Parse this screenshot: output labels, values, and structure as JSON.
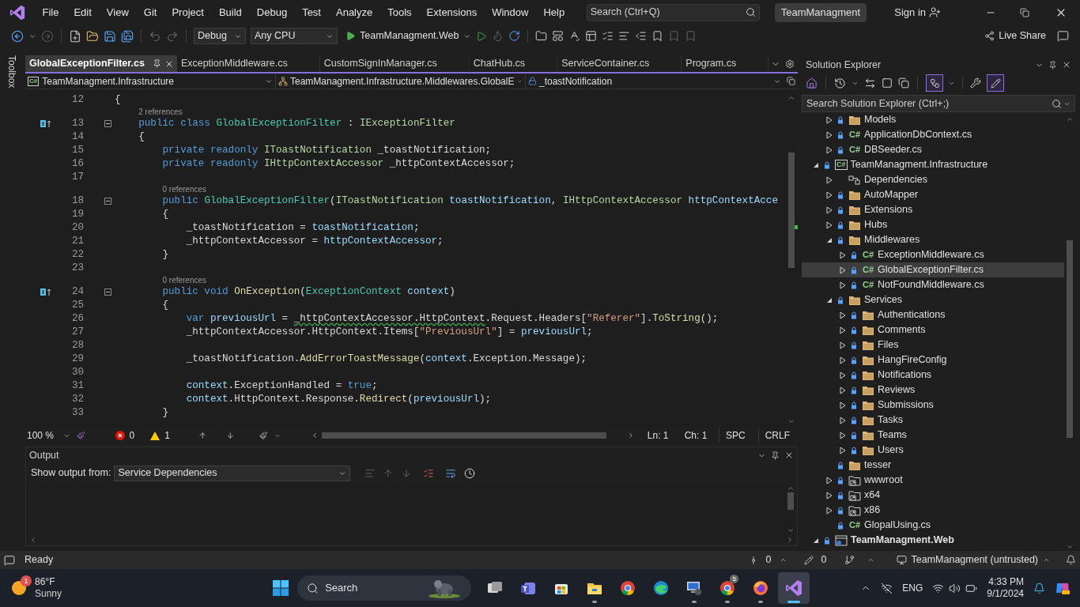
{
  "menu": [
    "File",
    "Edit",
    "View",
    "Git",
    "Project",
    "Build",
    "Debug",
    "Test",
    "Analyze",
    "Tools",
    "Extensions",
    "Window",
    "Help"
  ],
  "search": {
    "placeholder": "Search (Ctrl+Q)"
  },
  "solution_name": "TeamManagment",
  "sign_in": "Sign in",
  "toolbar": {
    "configuration": "Debug",
    "platform": "Any CPU",
    "startup": "TeamManagment.Web",
    "live_share": "Live Share"
  },
  "toolbox": "Toolbox",
  "tabs": [
    {
      "label": "GlobalExceptionFilter.cs",
      "selected": true
    },
    {
      "label": "ExceptionMiddleware.cs",
      "selected": false
    },
    {
      "label": "CustomSignInManager.cs",
      "selected": false
    },
    {
      "label": "ChatHub.cs",
      "selected": false
    },
    {
      "label": "ServiceContainer.cs",
      "selected": false
    },
    {
      "label": "Program.cs",
      "selected": false
    }
  ],
  "nav": {
    "project_icon": "C#",
    "project": "TeamManagment.Infrastructure",
    "type": "TeamManagment.Infrastructure.Middlewares.GlobalE",
    "member": "_toastNotification"
  },
  "code": [
    {
      "number": "12",
      "implements": false,
      "tokens": [
        {
          "kind": "p",
          "text": "{"
        }
      ]
    },
    {
      "number": "13",
      "implements": true,
      "lens": "2 references",
      "folded": false,
      "tokens": [
        {
          "kind": "k",
          "text": "    public class "
        },
        {
          "kind": "t",
          "text": "GlobalExceptionFilter"
        },
        {
          "kind": "p",
          "text": " : "
        },
        {
          "kind": "i",
          "text": "IExceptionFilter"
        }
      ]
    },
    {
      "number": "14",
      "implements": false,
      "tokens": [
        {
          "kind": "p",
          "text": "    {"
        }
      ]
    },
    {
      "number": "15",
      "implements": false,
      "tokens": [
        {
          "kind": "k",
          "text": "        private readonly "
        },
        {
          "kind": "i",
          "text": "IToastNotification"
        },
        {
          "kind": "p",
          "text": " _toastNotification;"
        }
      ]
    },
    {
      "number": "16",
      "implements": false,
      "tokens": [
        {
          "kind": "k",
          "text": "        private readonly "
        },
        {
          "kind": "i",
          "text": "IHttpContextAccessor"
        },
        {
          "kind": "p",
          "text": " _httpContextAccessor;"
        }
      ]
    },
    {
      "number": "17",
      "implements": false
    },
    {
      "number": "18",
      "implements": false,
      "lens": "0 references",
      "folded": false,
      "tokens": [
        {
          "kind": "k",
          "text": "        public "
        },
        {
          "kind": "t",
          "text": "GlobalExceptionFilter"
        },
        {
          "kind": "p",
          "text": "("
        },
        {
          "kind": "i",
          "text": "IToastNotification"
        },
        {
          "kind": "v",
          "text": " toastNotification"
        },
        {
          "kind": "p",
          "text": ", "
        },
        {
          "kind": "i",
          "text": "IHttpContextAccessor"
        },
        {
          "kind": "v",
          "text": " httpContextAcce"
        }
      ]
    },
    {
      "number": "19",
      "implements": false,
      "tokens": [
        {
          "kind": "p",
          "text": "        {"
        }
      ]
    },
    {
      "number": "20",
      "implements": false,
      "tokens": [
        {
          "kind": "p",
          "text": "            _toastNotification = "
        },
        {
          "kind": "v",
          "text": "toastNotification"
        },
        {
          "kind": "p",
          "text": ";"
        }
      ]
    },
    {
      "number": "21",
      "implements": false,
      "tokens": [
        {
          "kind": "p",
          "text": "            _httpContextAccessor = "
        },
        {
          "kind": "v",
          "text": "httpContextAccessor"
        },
        {
          "kind": "p",
          "text": ";"
        }
      ]
    },
    {
      "number": "22",
      "implements": false,
      "tokens": [
        {
          "kind": "p",
          "text": "        }"
        }
      ]
    },
    {
      "number": "23",
      "implements": false
    },
    {
      "number": "24",
      "implements": true,
      "lens": "0 references",
      "folded": false,
      "tokens": [
        {
          "kind": "k",
          "text": "        public void "
        },
        {
          "kind": "m",
          "text": "OnException"
        },
        {
          "kind": "p",
          "text": "("
        },
        {
          "kind": "t",
          "text": "ExceptionContext"
        },
        {
          "kind": "v",
          "text": " context"
        },
        {
          "kind": "p",
          "text": ")"
        }
      ]
    },
    {
      "number": "25",
      "implements": false,
      "tokens": [
        {
          "kind": "p",
          "text": "        {"
        }
      ]
    },
    {
      "number": "26",
      "implements": false,
      "tokens": [
        {
          "kind": "k",
          "text": "            var "
        },
        {
          "kind": "v",
          "text": "previousUrl"
        },
        {
          "kind": "p",
          "text": " = "
        },
        {
          "kind": "w",
          "text": "_httpContextAccessor.HttpContext"
        },
        {
          "kind": "p",
          "text": ".Request.Headers["
        },
        {
          "kind": "s",
          "text": "\"Referer\""
        },
        {
          "kind": "p",
          "text": "]."
        },
        {
          "kind": "m",
          "text": "ToString"
        },
        {
          "kind": "p",
          "text": "();"
        }
      ]
    },
    {
      "number": "27",
      "implements": false,
      "tokens": [
        {
          "kind": "p",
          "text": "            _httpContextAccessor.HttpContext.Items["
        },
        {
          "kind": "s",
          "text": "\"PreviousUrl\""
        },
        {
          "kind": "p",
          "text": "] = "
        },
        {
          "kind": "v",
          "text": "previousUrl"
        },
        {
          "kind": "p",
          "text": ";"
        }
      ]
    },
    {
      "number": "28",
      "implements": false
    },
    {
      "number": "29",
      "implements": false,
      "tokens": [
        {
          "kind": "p",
          "text": "            _toastNotification."
        },
        {
          "kind": "m",
          "text": "AddErrorToastMessage"
        },
        {
          "kind": "p",
          "text": "("
        },
        {
          "kind": "v",
          "text": "context"
        },
        {
          "kind": "p",
          "text": ".Exception.Message);"
        }
      ]
    },
    {
      "number": "30",
      "implements": false
    },
    {
      "number": "31",
      "implements": false,
      "tokens": [
        {
          "kind": "v",
          "text": "            context"
        },
        {
          "kind": "p",
          "text": ".ExceptionHandled = "
        },
        {
          "kind": "k",
          "text": "true"
        },
        {
          "kind": "p",
          "text": ";"
        }
      ]
    },
    {
      "number": "32",
      "implements": false,
      "tokens": [
        {
          "kind": "v",
          "text": "            context"
        },
        {
          "kind": "p",
          "text": ".HttpContext.Response."
        },
        {
          "kind": "m",
          "text": "Redirect"
        },
        {
          "kind": "p",
          "text": "("
        },
        {
          "kind": "v",
          "text": "previousUrl"
        },
        {
          "kind": "p",
          "text": ");"
        }
      ]
    },
    {
      "number": "33",
      "implements": false,
      "tokens": [
        {
          "kind": "p",
          "text": "        }"
        }
      ]
    }
  ],
  "editor_status": {
    "zoom": "100 %",
    "errors": "0",
    "warnings": "1",
    "line": "Ln: 1",
    "column": "Ch: 1",
    "whitespace": "SPC",
    "line_ending": "CRLF"
  },
  "output": {
    "title": "Output",
    "source_label": "Show output from:",
    "source": "Service Dependencies"
  },
  "solution_explorer": {
    "title": "Solution Explorer",
    "toggles": [
      {
        "kind": "track",
        "on": true
      },
      {
        "kind": "preview",
        "on": true
      }
    ],
    "search": {
      "placeholder": "Search Solution Explorer (Ctrl+;)"
    },
    "tree": [
      {
        "children": [
          {
            "label": "Models",
            "kind": "folder",
            "locked": true,
            "expanded": false,
            "selected": false
          },
          {
            "label": "ApplicationDbContext.cs",
            "kind": "csharp",
            "icon_text": "C#",
            "locked": true,
            "expanded": false,
            "selected": false
          },
          {
            "label": "DBSeeder.cs",
            "kind": "csharp",
            "icon_text": "C#",
            "locked": true,
            "expanded": false,
            "selected": false
          }
        ]
      },
      {
        "label": "TeamManagment.Infrastructure",
        "kind": "project",
        "icon_text": "C#",
        "locked": true,
        "expanded": true,
        "selected": false,
        "children": [
          {
            "label": "Dependencies",
            "kind": "dependencies",
            "locked": false,
            "expanded": false,
            "selected": false
          },
          {
            "label": "AutoMapper",
            "kind": "folder",
            "locked": true,
            "expanded": false,
            "selected": false
          },
          {
            "label": "Extensions",
            "kind": "folder",
            "locked": true,
            "expanded": false,
            "selected": false
          },
          {
            "label": "Hubs",
            "kind": "folder",
            "locked": true,
            "expanded": false,
            "selected": false
          },
          {
            "label": "Middlewares",
            "kind": "folder",
            "locked": true,
            "expanded": true,
            "selected": false,
            "children": [
              {
                "label": "ExceptionMiddleware.cs",
                "kind": "csharp",
                "icon_text": "C#",
                "locked": true,
                "expanded": false,
                "selected": false
              },
              {
                "label": "GlobalExceptionFilter.cs",
                "kind": "csharp",
                "icon_text": "C#",
                "locked": true,
                "expanded": false,
                "selected": true
              },
              {
                "label": "NotFoundMiddleware.cs",
                "kind": "csharp",
                "icon_text": "C#",
                "locked": true,
                "expanded": false,
                "selected": false
              }
            ]
          },
          {
            "label": "Services",
            "kind": "folder",
            "locked": true,
            "expanded": true,
            "selected": false,
            "children": [
              {
                "label": "Authentications",
                "kind": "folder",
                "locked": true,
                "expanded": false,
                "selected": false
              },
              {
                "label": "Comments",
                "kind": "folder",
                "locked": true,
                "expanded": false,
                "selected": false
              },
              {
                "label": "Files",
                "kind": "folder",
                "locked": true,
                "expanded": false,
                "selected": false
              },
              {
                "label": "HangFireConfig",
                "kind": "folder",
                "locked": true,
                "expanded": false,
                "selected": false
              },
              {
                "label": "Notifications",
                "kind": "folder",
                "locked": true,
                "expanded": false,
                "selected": false
              },
              {
                "label": "Reviews",
                "kind": "folder",
                "locked": true,
                "expanded": false,
                "selected": false
              },
              {
                "label": "Submissions",
                "kind": "folder",
                "locked": true,
                "expanded": false,
                "selected": false
              },
              {
                "label": "Tasks",
                "kind": "folder",
                "locked": true,
                "expanded": false,
                "selected": false
              },
              {
                "label": "Teams",
                "kind": "folder",
                "locked": true,
                "expanded": false,
                "selected": false
              },
              {
                "label": "Users",
                "kind": "folder",
                "locked": true,
                "expanded": false,
                "selected": false
              }
            ]
          },
          {
            "label": "tesser",
            "kind": "folder",
            "locked": true,
            "selected": false
          },
          {
            "label": "wwwroot",
            "kind": "linked-folder",
            "locked": true,
            "expanded": false,
            "selected": false
          },
          {
            "label": "x64",
            "kind": "linked-folder",
            "locked": true,
            "expanded": false,
            "selected": false
          },
          {
            "label": "x86",
            "kind": "linked-folder",
            "locked": true,
            "expanded": false,
            "selected": false
          },
          {
            "label": "GlopalUsing.cs",
            "kind": "csharp",
            "icon_text": "C#",
            "locked": true,
            "selected": false
          }
        ]
      },
      {
        "label": "TeamManagment.Web",
        "kind": "web-project",
        "locked": true,
        "expanded": true,
        "selected": false,
        "bold": true
      }
    ]
  },
  "status_bar": {
    "status": "Ready",
    "commits": "0",
    "changes": "0",
    "repository": "TeamManagment (untrusted)"
  },
  "taskbar": {
    "temperature": "86°F",
    "weather": "Sunny",
    "weather_badge": "1",
    "search": "Search",
    "language": "ENG",
    "time": "4:33 PM",
    "date": "9/1/2024",
    "apps": [
      {
        "kind": "task-view",
        "running": false,
        "active": false
      },
      {
        "kind": "teams",
        "running": false,
        "active": false
      },
      {
        "kind": "store",
        "running": false,
        "active": false
      },
      {
        "kind": "explorer",
        "running": true,
        "active": false
      },
      {
        "kind": "chrome",
        "running": false,
        "active": false
      },
      {
        "kind": "edge",
        "running": false,
        "active": false
      },
      {
        "kind": "remote",
        "running": true,
        "active": false
      },
      {
        "kind": "chrome",
        "running": true,
        "active": false,
        "badge": "5"
      },
      {
        "kind": "firefox",
        "running": true,
        "active": false
      },
      {
        "kind": "visual-studio",
        "running": true,
        "active": true
      }
    ]
  }
}
